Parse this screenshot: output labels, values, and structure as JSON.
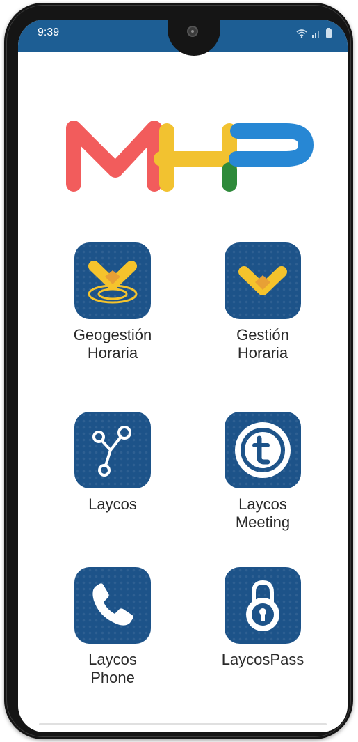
{
  "status_bar": {
    "time": "9:39",
    "icons": [
      "wifi-icon",
      "signal-icon",
      "battery-icon"
    ],
    "color": "#1d5e94"
  },
  "logo": {
    "text": "MHP",
    "colors": [
      "#f25c5c",
      "#f2c230",
      "#2e8a3a",
      "#2787d4"
    ]
  },
  "apps": [
    {
      "label": "Geogestión\nHoraria",
      "icon": "geogestion-icon"
    },
    {
      "label": "Gestión\nHoraria",
      "icon": "gestion-horaria-icon"
    },
    {
      "label": "Laycos",
      "icon": "laycos-icon"
    },
    {
      "label": "Laycos\nMeeting",
      "icon": "laycos-meeting-icon"
    },
    {
      "label": "Laycos\nPhone",
      "icon": "laycos-phone-icon"
    },
    {
      "label": "LaycosPass",
      "icon": "laycospass-icon"
    }
  ],
  "theme": {
    "icon_bg": "#1d5389",
    "accent_yellow": "#f5c32c",
    "accent_orange": "#e8a035"
  }
}
